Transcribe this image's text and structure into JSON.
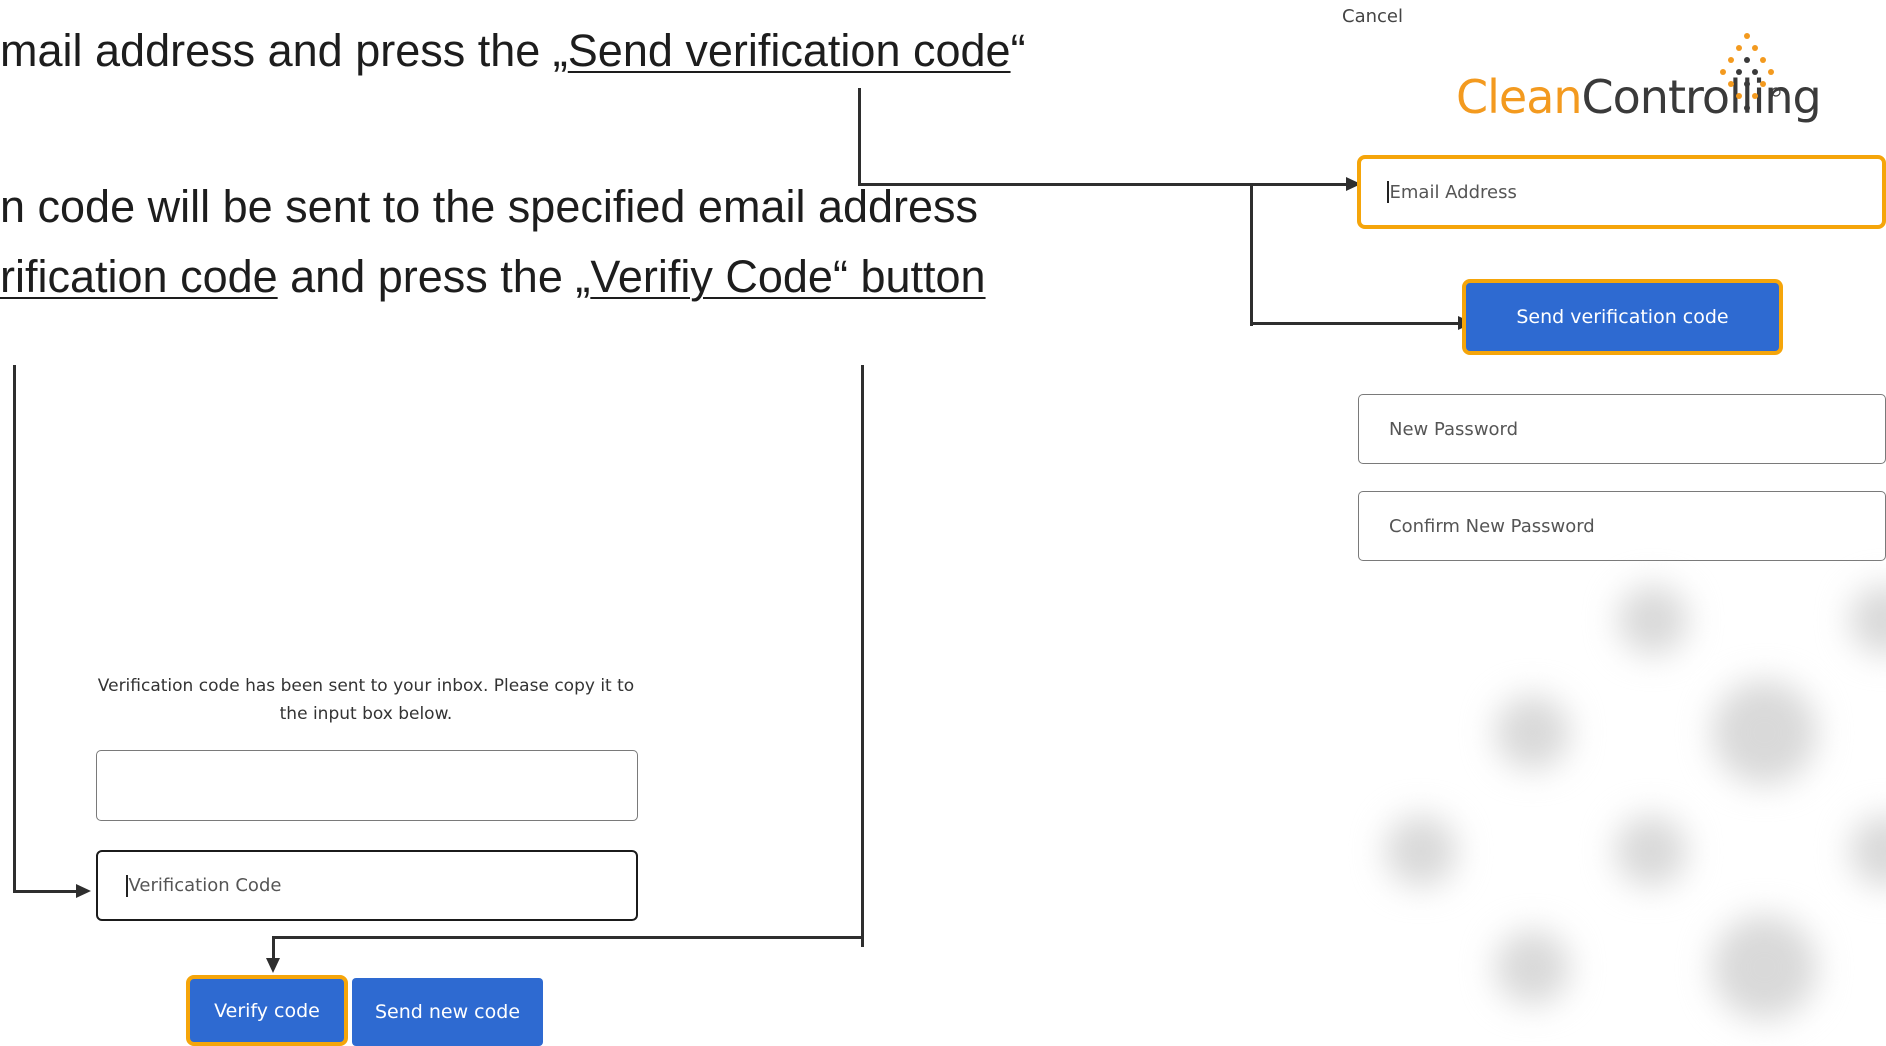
{
  "instructions": {
    "line1": {
      "prefix": "mail address and press the „",
      "link": "Send verification code",
      "suffix": "“"
    },
    "line2": "n code will be sent to the specified email address",
    "line3": {
      "link1": "rification code",
      "middle": " and press the „",
      "link2": "Verifiy Code“ button"
    }
  },
  "reset_panel": {
    "cancel_label": "Cancel",
    "logo": {
      "part1": "Clean",
      "part2": "Controlling"
    },
    "email_placeholder": "Email Address",
    "send_code_label": "Send verification code",
    "new_password_placeholder": "New Password",
    "confirm_password_placeholder": "Confirm New Password"
  },
  "verify_panel": {
    "message": "Verification code has been sent to your inbox. Please copy it to the input box below.",
    "code_placeholder": "Verification Code",
    "verify_label": "Verify code",
    "send_new_label": "Send new code"
  },
  "colors": {
    "highlight": "#f5a50a",
    "button": "#2e6ad1",
    "logo_orange": "#f39a1f",
    "logo_gray": "#3a3a3a"
  }
}
